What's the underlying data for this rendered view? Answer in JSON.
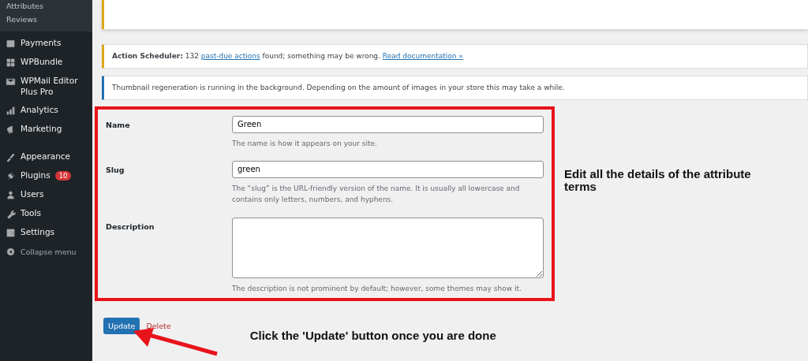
{
  "sidebar": {
    "submenu": [
      "Attributes",
      "Reviews"
    ],
    "items": [
      {
        "label": "Payments"
      },
      {
        "label": "WPBundle"
      },
      {
        "label": "WPMail Editor Plus Pro"
      },
      {
        "label": "Analytics"
      },
      {
        "label": "Marketing"
      },
      {
        "label": "Appearance"
      },
      {
        "label": "Plugins",
        "badge": "10"
      },
      {
        "label": "Users"
      },
      {
        "label": "Tools"
      },
      {
        "label": "Settings"
      }
    ],
    "collapse": "Collapse menu"
  },
  "notices": [
    {
      "kind": "warning",
      "title": "Action Scheduler:",
      "text_before": " 132 ",
      "link": "past-due actions",
      "text_after": " found; something may be wrong. ",
      "link2": "Read documentation »"
    },
    {
      "kind": "info",
      "text": "Thumbnail regeneration is running in the background. Depending on the amount of images in your store this may take a while."
    }
  ],
  "form": {
    "fields": [
      {
        "kind": "input",
        "label": "Name",
        "value": "Green",
        "help": "The name is how it appears on your site."
      },
      {
        "kind": "input",
        "label": "Slug",
        "value": "green",
        "help": "The “slug” is the URL-friendly version of the name. It is usually all lowercase and contains only letters, numbers, and hyphens."
      },
      {
        "kind": "textarea",
        "label": "Description",
        "help": "The description is not prominent by default; however, some themes may show it."
      }
    ]
  },
  "buttons": {
    "update": "Update",
    "delete": "Delete"
  },
  "annotations": {
    "form_note": "Edit all the details of the attribute terms",
    "button_note": "Click the 'Update' button once you are done"
  }
}
